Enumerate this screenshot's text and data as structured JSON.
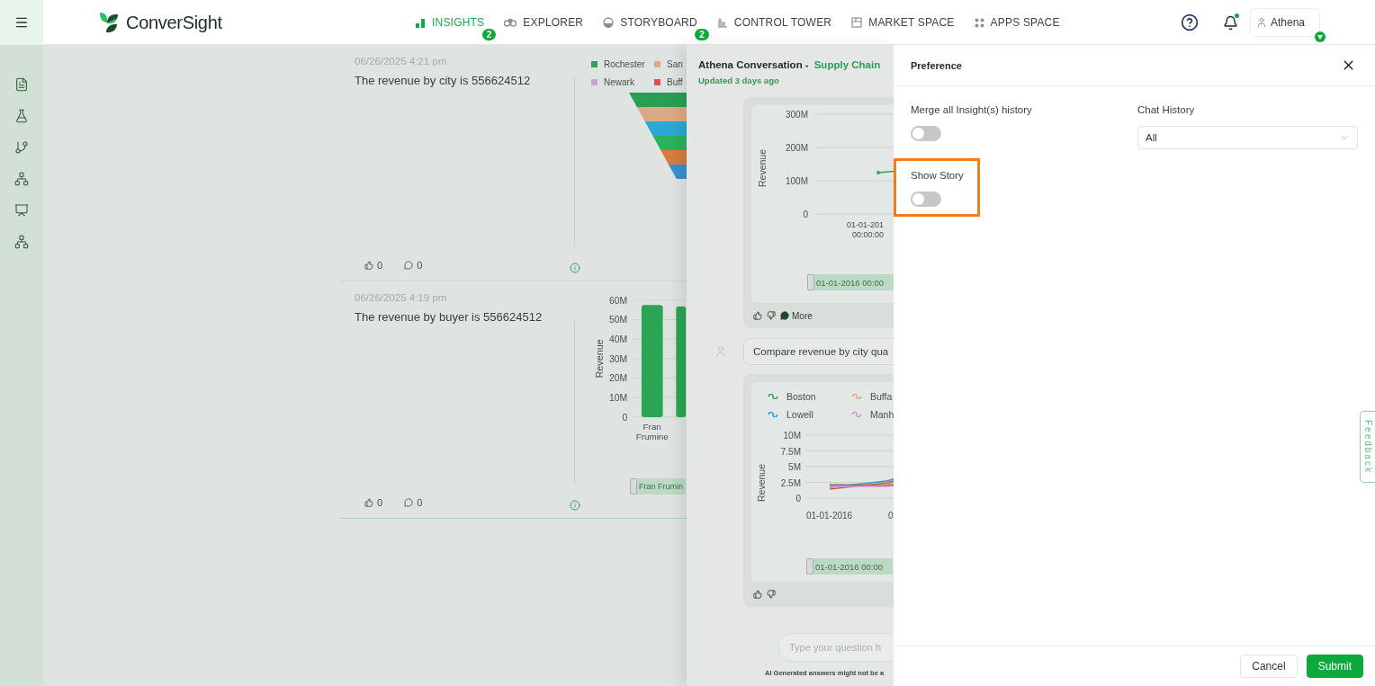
{
  "topbar": {
    "brand": "ConverSight",
    "nav": [
      {
        "label": "INSIGHTS",
        "kind": "bars",
        "selected": true,
        "badge": "2"
      },
      {
        "label": "EXPLORER",
        "kind": "binoculars",
        "selected": false
      },
      {
        "label": "STORYBOARD",
        "kind": "globe",
        "selected": false,
        "badge": "2"
      },
      {
        "label": "CONTROL TOWER",
        "kind": "tower",
        "selected": false
      },
      {
        "label": "MARKET SPACE",
        "kind": "market",
        "selected": false
      },
      {
        "label": "APPS SPACE",
        "kind": "apps",
        "selected": false
      }
    ],
    "notifications_unread": true,
    "user": "Athena"
  },
  "sidebar": {
    "items": [
      {
        "kind": "report"
      },
      {
        "kind": "flask"
      },
      {
        "kind": "branch"
      },
      {
        "kind": "hierarchy"
      },
      {
        "kind": "presentation"
      },
      {
        "kind": "hierarchy"
      }
    ]
  },
  "insights": [
    {
      "time": "06/26/2025 4:21 pm",
      "text": "The revenue by city is 556624512",
      "likes": "0",
      "comments": "0",
      "chart": {
        "kind": "funnel",
        "legend": [
          {
            "label": "Rochester",
            "color": "#2ca456"
          },
          {
            "label": "San",
            "color": "#dfa886"
          },
          {
            "label": "Newark",
            "color": "#d49ee0"
          },
          {
            "label": "Buff",
            "color": "#d9534f"
          }
        ]
      }
    },
    {
      "time": "06/26/2025 4:19 pm",
      "text": "The revenue by buyer is 556624512",
      "likes": "0",
      "comments": "0",
      "chart": {
        "kind": "bar",
        "range": {
          "label": "Fran Frumin",
          "level": 1
        },
        "chart_data": {
          "type": "bar",
          "ylabel": "Revenue",
          "ylim": [
            0,
            60000000
          ],
          "grid": true,
          "categories": [
            "Fran Frumine",
            null
          ],
          "values": [
            57500000,
            56800000
          ],
          "yticks": [
            {
              "value": 0,
              "label": "0"
            },
            {
              "value": 10000000,
              "label": "10M"
            },
            {
              "value": 20000000,
              "label": "20M"
            },
            {
              "value": 30000000,
              "label": "30M"
            },
            {
              "value": 40000000,
              "label": "40M"
            },
            {
              "value": 50000000,
              "label": "50M"
            },
            {
              "value": 60000000,
              "label": "60M"
            }
          ]
        }
      }
    }
  ],
  "conversation": {
    "title": "Athena Conversation -",
    "subject": "Supply Chain",
    "updated": "Updated 3 days ago",
    "messages": [
      {
        "kind": "answer",
        "ylabel": "Revenue",
        "y_labels": [
          "300M",
          "200M",
          "100M",
          "0"
        ],
        "x_labels": [
          "01-01-201\n00:00:00"
        ],
        "range": {
          "label": "01-01-2016 00:00",
          "level": 1
        },
        "more": "More"
      },
      {
        "kind": "question",
        "text": "Compare revenue by city qua"
      },
      {
        "kind": "answer",
        "legend": [
          {
            "label": "Boston",
            "color": "#2ca456"
          },
          {
            "label": "Buffa",
            "color": "#f0a070"
          },
          {
            "label": "Lowell",
            "color": "#2a9fd0"
          },
          {
            "label": "Manh",
            "color": "#d68ee0"
          }
        ],
        "ylabel": "Revenue",
        "y_labels": [
          "10M",
          "7.5M",
          "5M",
          "2.5M",
          "0"
        ],
        "x_labels": [
          "01-01-2016",
          "0"
        ],
        "range": {
          "label": "01-01-2016 00:00",
          "level": 1
        }
      }
    ],
    "input": {
      "placeholder": "Type your question h"
    },
    "disclaimer": "AI Generated answers might not be a"
  },
  "preference": {
    "title": "Preference",
    "settings": [
      {
        "kind": "toggle",
        "label": "Merge all Insight(s) history",
        "on": false,
        "highlighted": false
      },
      {
        "kind": "select",
        "label": "Chat History",
        "value": "All"
      },
      {
        "kind": "toggle",
        "label": "Show Story",
        "on": false,
        "highlighted": true
      }
    ],
    "buttons": [
      {
        "label": "Cancel",
        "kind": "secondary"
      },
      {
        "label": "Submit",
        "kind": "primary"
      }
    ]
  },
  "feedback_tab": "Feedback"
}
